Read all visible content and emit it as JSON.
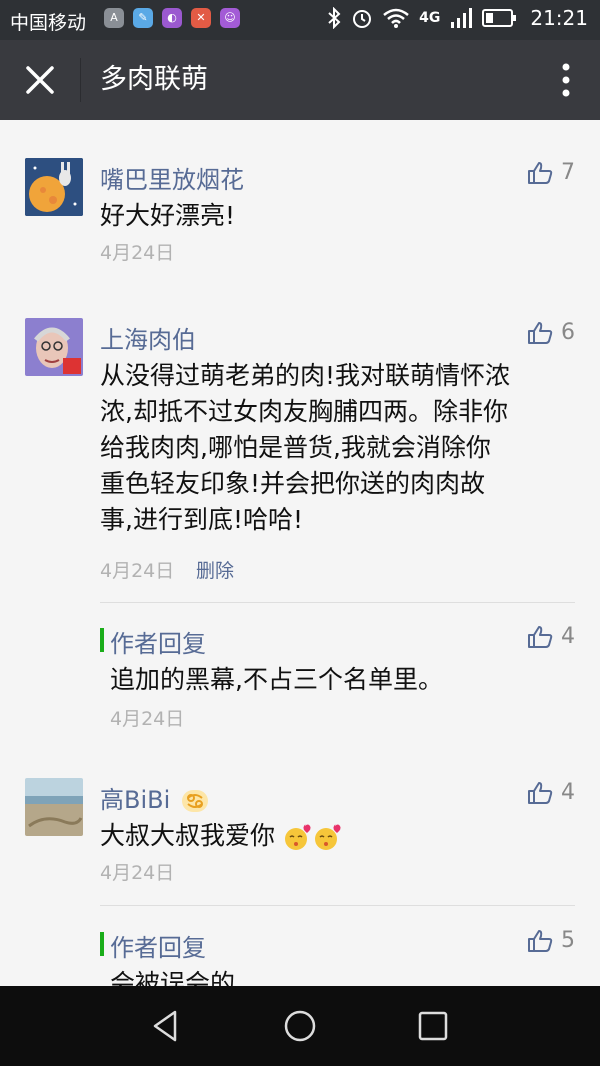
{
  "status_bar": {
    "carrier": "中国移动",
    "app_icons": [
      {
        "icon": "a-store-icon",
        "label": "A",
        "color": "#8a8f96"
      },
      {
        "icon": "tools-icon",
        "label": "✎",
        "color": "#5aa9e6"
      },
      {
        "icon": "purple-app-icon",
        "label": "◐",
        "color": "#9b59d0"
      },
      {
        "icon": "red-app-icon",
        "label": "✕",
        "color": "#e25b45"
      },
      {
        "icon": "cat-app-icon",
        "label": "☺",
        "color": "#a35bd6"
      }
    ],
    "network": "4G",
    "time": "21:21"
  },
  "header": {
    "title": "多肉联萌"
  },
  "comments": [
    {
      "name": "嘴巴里放烟花",
      "text": "好大好漂亮!",
      "date": "4月24日",
      "likes": "7",
      "avatar": "rabbit-moon-avatar"
    },
    {
      "name": "上海肉伯",
      "text_lines": [
        "从没得过萌老弟的肉!我对联萌情怀浓",
        "浓,却抵不过女肉友胸脯四两。除非你",
        "给我肉肉,哪怕是普货,我就会消除你",
        "重色轻友印象!并会把你送的肉肉故",
        "事,进行到底!哈哈!"
      ],
      "date": "4月24日",
      "delete_label": "删除",
      "likes": "6",
      "avatar": "old-man-avatar",
      "reply": {
        "label": "作者回复",
        "text": "追加的黑幕,不占三个名单里。",
        "date": "4月24日",
        "likes": "4"
      }
    },
    {
      "name": "高BiBi",
      "text": "大叔大叔我爱你",
      "date": "4月24日",
      "likes": "4",
      "avatar": "beach-avatar",
      "reply": {
        "label": "作者回复",
        "text": "会被误会的。",
        "likes": "5"
      }
    }
  ],
  "colors": {
    "link": "#576b95",
    "reply_accent": "#1aad19",
    "header_bg": "#393a3f"
  }
}
